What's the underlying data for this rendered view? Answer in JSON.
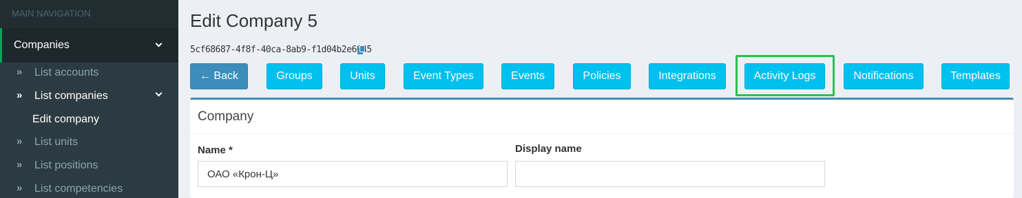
{
  "sidebar": {
    "header": "MAIN NAVIGATION",
    "active_menu": "Companies",
    "items": [
      {
        "label": "List accounts"
      },
      {
        "label": "List companies"
      },
      {
        "label": "Edit company"
      },
      {
        "label": "List units"
      },
      {
        "label": "List positions"
      },
      {
        "label": "List competencies"
      }
    ]
  },
  "page": {
    "title": "Edit Company 5",
    "uuid": "5cf68687-4f8f-40ca-8ab9-f1d04b2e6045"
  },
  "toolbar": {
    "back": "← Back",
    "groups": "Groups",
    "units": "Units",
    "event_types": "Event Types",
    "events": "Events",
    "policies": "Policies",
    "integrations": "Integrations",
    "activity_logs": "Activity Logs",
    "notifications": "Notifications",
    "templates": "Templates"
  },
  "form": {
    "title": "Company",
    "name_label": "Name *",
    "name_value": "ОАО «Крон-Ц»",
    "display_name_label": "Display name",
    "display_name_value": ""
  },
  "colors": {
    "accent": "#00c0ef",
    "primary": "#3c8dbc",
    "highlight": "#24c54b",
    "sidebar": "#222d32"
  }
}
